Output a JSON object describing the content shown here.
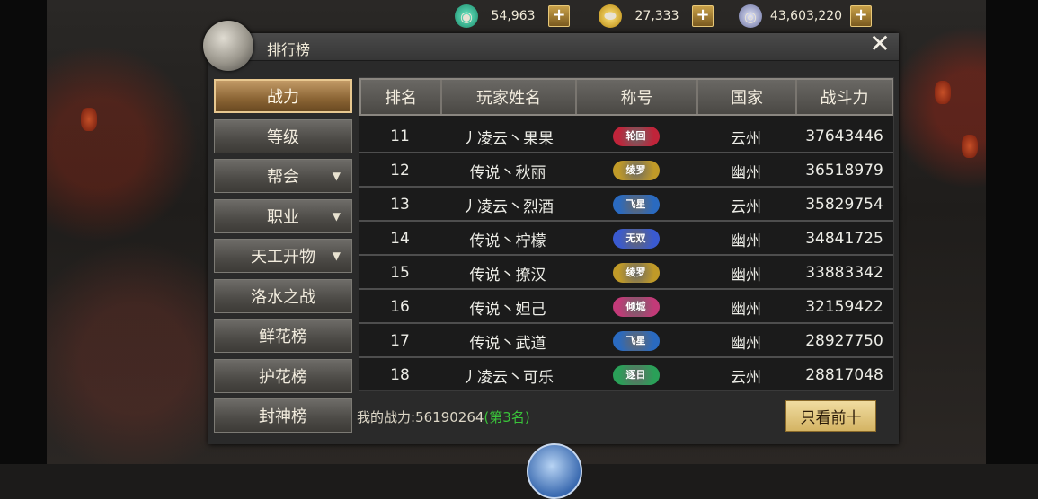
{
  "currency": [
    {
      "icon": "jade-icon",
      "value": "54,963",
      "color": "#2fc4a0"
    },
    {
      "icon": "gold-ingot-icon",
      "value": "27,333",
      "color": "#e8b830"
    },
    {
      "icon": "silver-coin-icon",
      "value": "43,603,220",
      "color": "#a8b0d8"
    }
  ],
  "plus_label": "+",
  "panel": {
    "title": "排行榜",
    "close": "✕"
  },
  "side_menu": [
    {
      "label": "战力",
      "active": true,
      "arrow": ""
    },
    {
      "label": "等级",
      "active": false,
      "arrow": ""
    },
    {
      "label": "帮会",
      "active": false,
      "arrow": "▼"
    },
    {
      "label": "职业",
      "active": false,
      "arrow": "▼"
    },
    {
      "label": "天工开物",
      "active": false,
      "arrow": "▼"
    },
    {
      "label": "洛水之战",
      "active": false,
      "arrow": ""
    },
    {
      "label": "鲜花榜",
      "active": false,
      "arrow": ""
    },
    {
      "label": "护花榜",
      "active": false,
      "arrow": ""
    },
    {
      "label": "封神榜",
      "active": false,
      "arrow": ""
    }
  ],
  "table": {
    "headers": [
      "排名",
      "玩家姓名",
      "称号",
      "国家",
      "战斗力"
    ],
    "rows": [
      {
        "rank": "11",
        "name": "丿凌云丶果果",
        "badge": "轮回",
        "badge_color": "#c0243a",
        "country": "云州",
        "power": "37643446"
      },
      {
        "rank": "12",
        "name": "传说丶秋丽",
        "badge": "绫罗",
        "badge_color": "#c09a28",
        "country": "幽州",
        "power": "36518979"
      },
      {
        "rank": "13",
        "name": "丿凌云丶烈酒",
        "badge": "飞星",
        "badge_color": "#2a6ac0",
        "country": "云州",
        "power": "35829754"
      },
      {
        "rank": "14",
        "name": "传说丶柠檬",
        "badge": "无双",
        "badge_color": "#3a5ad0",
        "country": "幽州",
        "power": "34841725"
      },
      {
        "rank": "15",
        "name": "传说丶撩汉",
        "badge": "绫罗",
        "badge_color": "#c09a28",
        "country": "幽州",
        "power": "33883342"
      },
      {
        "rank": "16",
        "name": "传说丶妲己",
        "badge": "倾城",
        "badge_color": "#c23a78",
        "country": "幽州",
        "power": "32159422"
      },
      {
        "rank": "17",
        "name": "传说丶武道",
        "badge": "飞星",
        "badge_color": "#2a6ac0",
        "country": "幽州",
        "power": "28927750"
      },
      {
        "rank": "18",
        "name": "丿凌云丶可乐",
        "badge": "逐日",
        "badge_color": "#2aa058",
        "country": "云州",
        "power": "28817048"
      }
    ]
  },
  "footer": {
    "label": "我的战力:",
    "value": "56190264",
    "rank": "(第3名)",
    "button": "只看前十"
  }
}
